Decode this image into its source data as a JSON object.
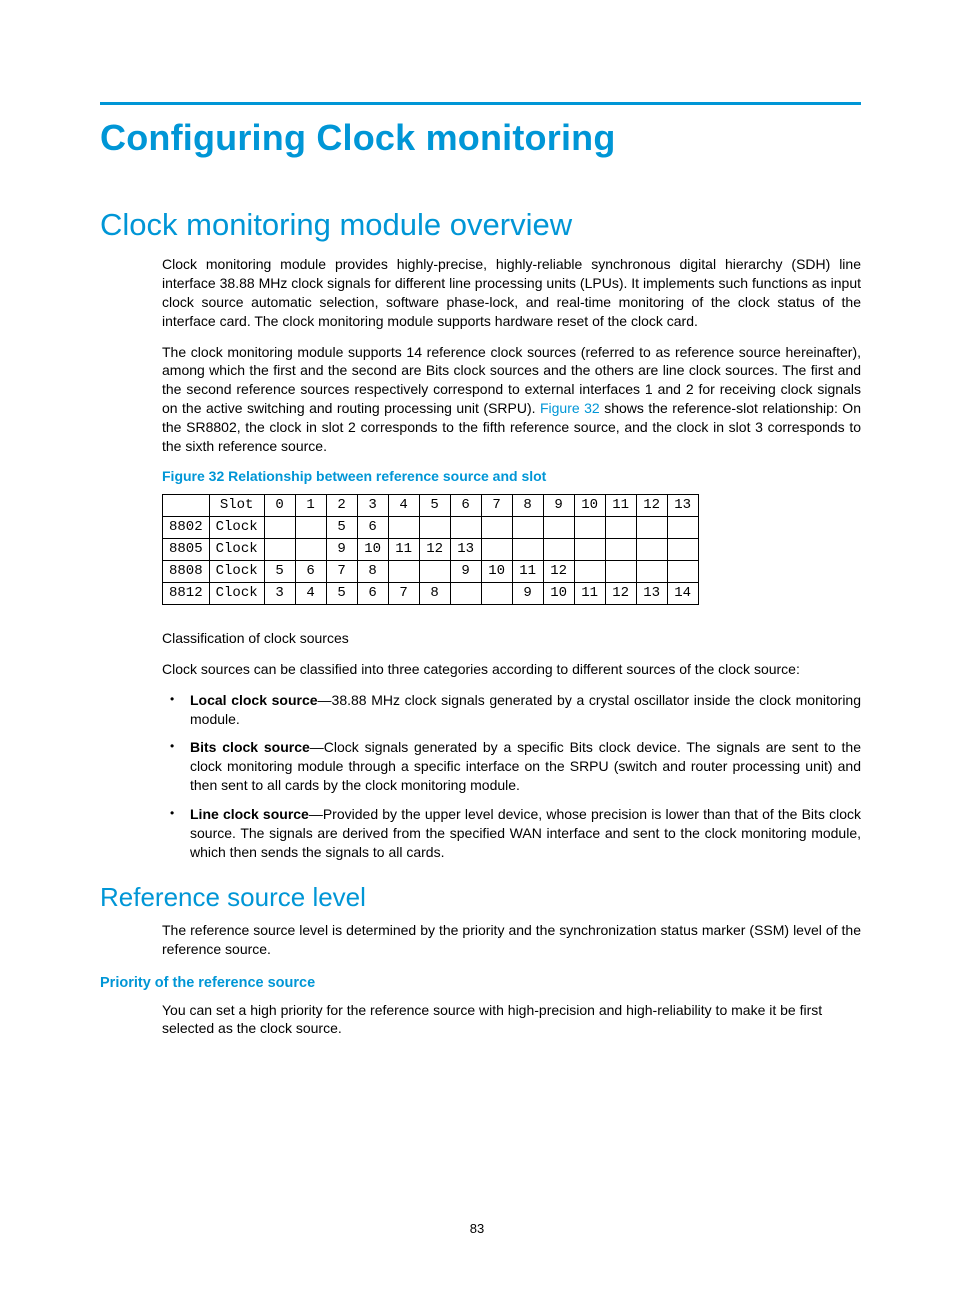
{
  "title": "Configuring Clock monitoring",
  "section_overview": {
    "heading": "Clock monitoring module overview",
    "p1": "Clock monitoring module provides highly-precise, highly-reliable synchronous digital hierarchy (SDH) line interface 38.88 MHz clock signals for different line processing units (LPUs). It implements such functions as input clock source automatic selection, software phase-lock, and real-time monitoring of the clock status of the interface card. The clock monitoring module supports hardware reset of the clock card.",
    "p2_pre": "The clock monitoring module supports 14 reference clock sources (referred to as reference source hereinafter), among which the first and the second are Bits clock sources and the others are line clock sources. The first and the second reference sources respectively correspond to external interfaces 1 and 2 for receiving clock signals on the active switching and routing processing unit (SRPU). ",
    "p2_link": "Figure 32",
    "p2_post": " shows the reference-slot relationship: On the SR8802, the clock in slot 2 corresponds to the fifth reference source, and the clock in slot 3 corresponds to the sixth reference source.",
    "figure_caption": "Figure 32 Relationship between reference source and slot"
  },
  "chart_data": {
    "type": "table",
    "header_label": "Slot",
    "col_label": "Clock",
    "slots": [
      "0",
      "1",
      "2",
      "3",
      "4",
      "5",
      "6",
      "7",
      "8",
      "9",
      "10",
      "11",
      "12",
      "13"
    ],
    "rows": [
      {
        "device": "8802",
        "values": [
          "",
          "",
          "5",
          "6",
          "",
          "",
          "",
          "",
          "",
          "",
          "",
          "",
          "",
          ""
        ]
      },
      {
        "device": "8805",
        "values": [
          "",
          "",
          "9",
          "10",
          "11",
          "12",
          "13",
          "",
          "",
          "",
          "",
          "",
          "",
          ""
        ]
      },
      {
        "device": "8808",
        "values": [
          "5",
          "6",
          "7",
          "8",
          "",
          "",
          "9",
          "10",
          "11",
          "12",
          "",
          "",
          "",
          ""
        ]
      },
      {
        "device": "8812",
        "values": [
          "3",
          "4",
          "5",
          "6",
          "7",
          "8",
          "",
          "",
          "9",
          "10",
          "11",
          "12",
          "13",
          "14"
        ]
      }
    ]
  },
  "classification": {
    "heading": "Classification of clock sources",
    "lead": "Clock sources can be classified into three categories according to different sources of the clock source:",
    "items": [
      {
        "term": "Local clock source",
        "text": "—38.88 MHz clock signals generated by a crystal oscillator inside the clock monitoring module."
      },
      {
        "term": "Bits clock source",
        "text": "—Clock signals generated by a specific Bits clock device. The signals are sent to the clock monitoring module through a specific interface on the SRPU (switch and router processing unit) and then sent to all cards by the clock monitoring module."
      },
      {
        "term": "Line clock source",
        "text": "—Provided by the upper level device, whose precision is lower than that of the Bits clock source. The signals are derived from the specified WAN interface and sent to the clock monitoring module, which then sends the signals to all cards."
      }
    ]
  },
  "ref_level": {
    "heading": "Reference source level",
    "p": "The reference source level is determined by the priority and the synchronization status marker (SSM) level of the reference source.",
    "sub_heading": "Priority of the reference source",
    "sub_p": "You can set a high priority for the reference source with high-precision and high-reliability to make it be first selected as the clock source."
  },
  "page_number": "83"
}
